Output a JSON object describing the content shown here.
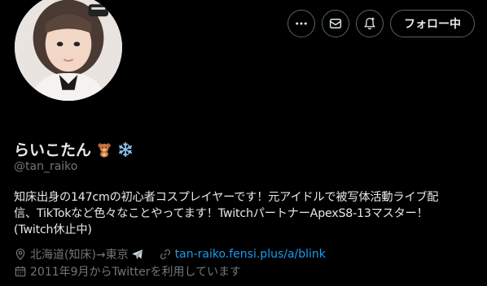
{
  "profile": {
    "display_name": "らいこたん",
    "handle": "@tan_raiko",
    "bio_lines": [
      "知床出身の147cmの初心者コスプレイヤーです！元アイドルで被写体活動ライブ配",
      "信、TikTokなど色々なことやってます！TwitchパートナーApexS8-13マスター！",
      "(Twitch休止中)"
    ],
    "location": "北海道(知床)→東京",
    "website": "tan-raiko.fensi.plus/a/blink",
    "joined": "2011年9月からTwitterを利用しています"
  },
  "actions": {
    "follow_label": "フォロー中"
  },
  "icons": {
    "more": "more-icon",
    "message": "message-icon",
    "notify": "notification-bell-icon",
    "location": "location-pin-icon",
    "link": "link-icon",
    "calendar": "calendar-icon",
    "name_emoji_1": "teddy-bear-icon",
    "name_emoji_2": "snowflake-icon",
    "location_emoji": "airplane-icon"
  },
  "colors": {
    "background": "#000000",
    "text": "#e7e9ea",
    "secondary": "#71767b",
    "link": "#1d9bf0",
    "border": "#536471"
  }
}
